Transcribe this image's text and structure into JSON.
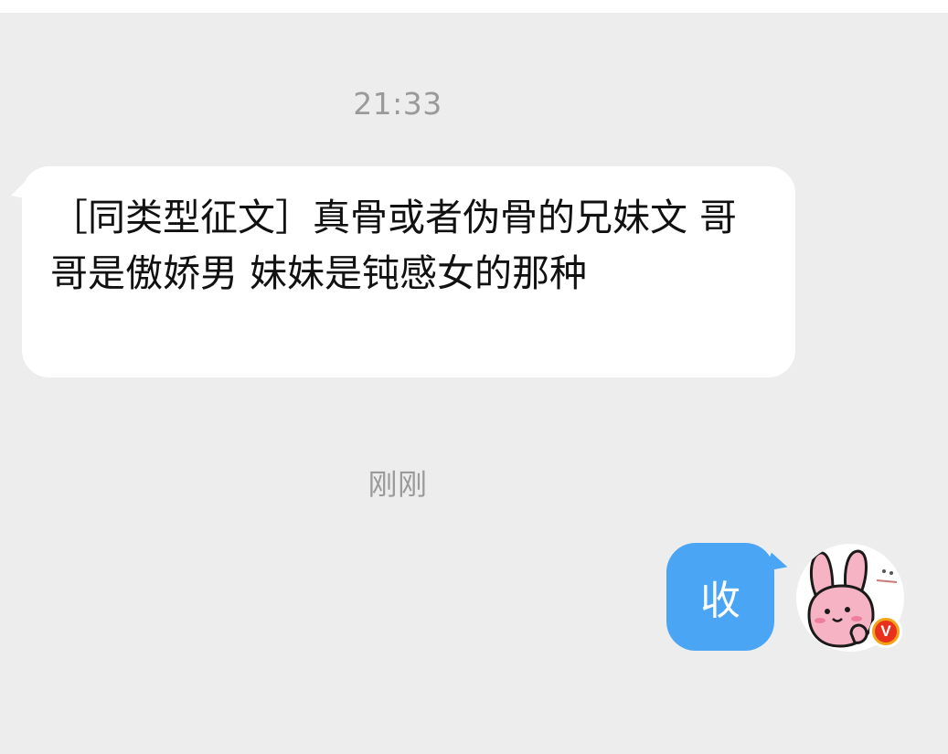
{
  "chat": {
    "timestamp_1": "21:33",
    "incoming_message": "［同类型征文］真骨或者伪骨的兄妹文 哥哥是傲娇男 妹妹是钝感女的那种",
    "timestamp_2": "刚刚",
    "outgoing_message": "收"
  },
  "avatar": {
    "icon": "pink-bunny-avatar-icon",
    "badge_label": "V",
    "badge_icon": "vip-verified-icon"
  },
  "colors": {
    "background": "#ededed",
    "incoming_bubble": "#ffffff",
    "outgoing_bubble": "#4aa5f5",
    "timestamp_text": "#9a9a9a",
    "badge": "#f5a316"
  }
}
